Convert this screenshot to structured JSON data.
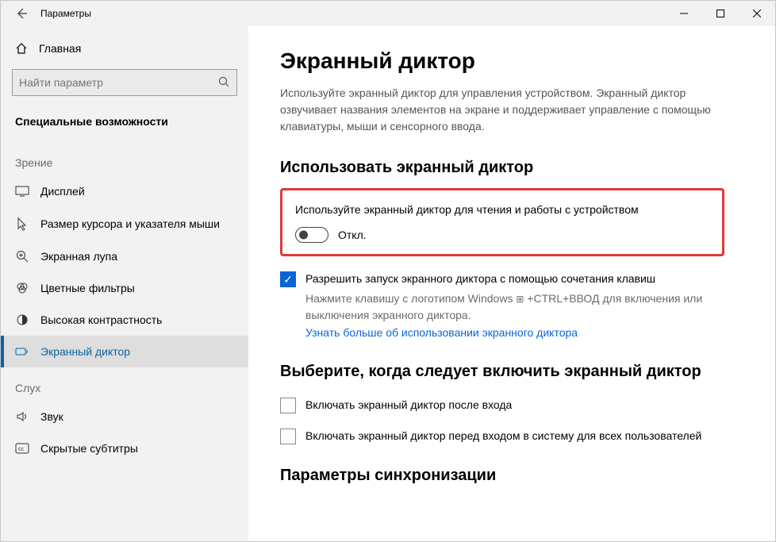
{
  "titlebar": {
    "title": "Параметры"
  },
  "sidebar": {
    "home": "Главная",
    "search_placeholder": "Найти параметр",
    "category": "Специальные возможности",
    "group_vision": "Зрение",
    "group_hearing": "Слух",
    "items": {
      "display": "Дисплей",
      "cursor": "Размер курсора и указателя мыши",
      "magnifier": "Экранная лупа",
      "colorfilters": "Цветные фильтры",
      "highcontrast": "Высокая контрастность",
      "narrator": "Экранный диктор",
      "sound": "Звук",
      "captions": "Скрытые субтитры"
    }
  },
  "content": {
    "title": "Экранный диктор",
    "desc": "Используйте экранный диктор для управления устройством. Экранный диктор озвучивает названия элементов на экране и поддерживает управление с помощью клавиатуры, мыши и сенсорного ввода.",
    "use_section": "Использовать экранный диктор",
    "toggle_label": "Используйте экранный диктор для чтения и работы с устройством",
    "toggle_state": "Откл.",
    "checkbox_shortcut": "Разрешить запуск экранного диктора с помощью сочетания клавиш",
    "shortcut_help_pre": "Нажмите клавишу с логотипом Windows ",
    "shortcut_help_post": " +CTRL+ВВОД для включения или выключения экранного диктора.",
    "learn_more": "Узнать больше об использовании экранного диктора",
    "when_section": "Выберите, когда следует включить экранный диктор",
    "opt_after_signin": "Включать экранный диктор после входа",
    "opt_before_signin": "Включать экранный диктор перед входом в систему для всех пользователей",
    "sync_section": "Параметры синхронизации"
  }
}
